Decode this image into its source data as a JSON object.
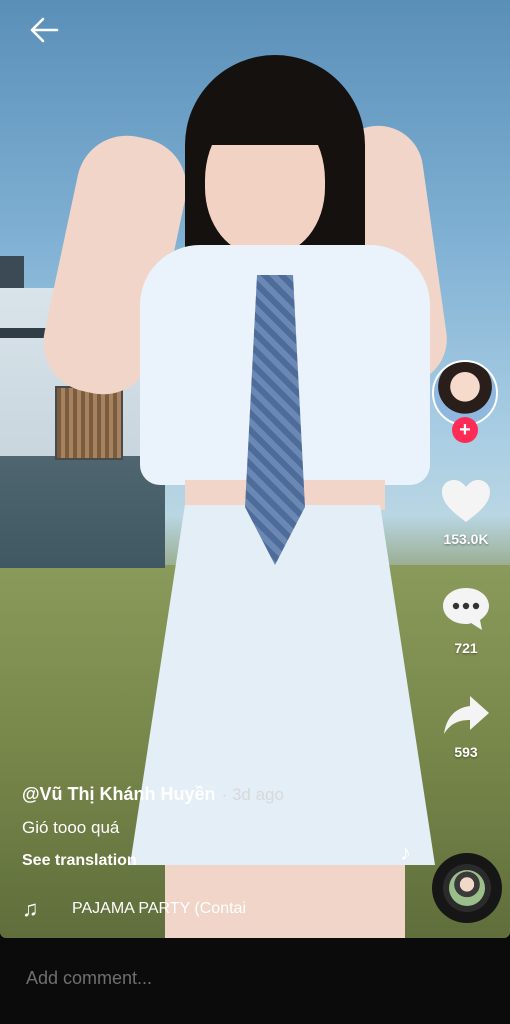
{
  "header": {
    "back_icon": "arrow-left-icon"
  },
  "creator": {
    "avatar_icon": "creator-avatar",
    "follow_symbol": "+"
  },
  "actions": {
    "likes": "153.0K",
    "comments": "721",
    "shares": "593"
  },
  "post": {
    "author": "@Vũ Thị Khánh Huyền",
    "time_ago": "· 3d ago",
    "caption": "Gió tooo quá",
    "translate_label": "See translation"
  },
  "music": {
    "song": "PAJAMA PARTY (Contai",
    "note_icon": "music-note-icon"
  },
  "comment_box": {
    "placeholder": "Add comment..."
  },
  "colors": {
    "follow": "#fe2c55",
    "bottom_bar": "#0b0b0b"
  }
}
